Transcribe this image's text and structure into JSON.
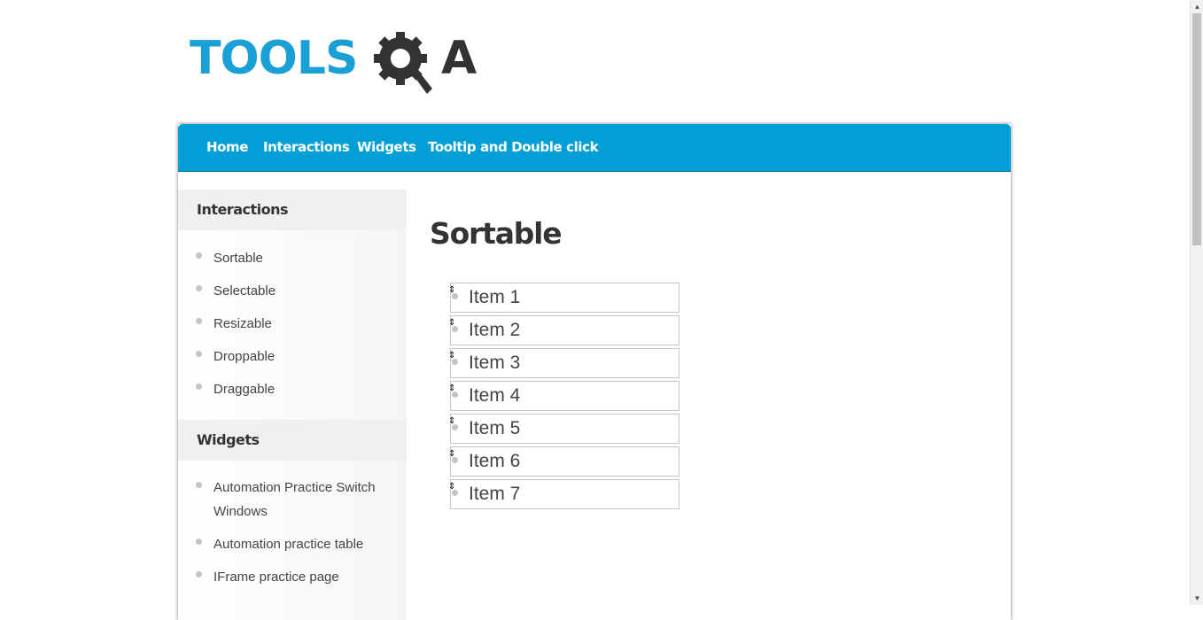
{
  "logo": {
    "text_left": "TOOLS",
    "text_right": "A",
    "icon": "gear-magnifier-icon",
    "colors": {
      "blue": "#1ba0d6",
      "dark": "#333333"
    }
  },
  "nav": {
    "background": "#029fd6",
    "items": [
      "Home",
      "Interactions",
      "Widgets",
      "Tooltip and Double click"
    ]
  },
  "sidebar": {
    "sections": [
      {
        "title": "Interactions",
        "items": [
          "Sortable",
          "Selectable",
          "Resizable",
          "Droppable",
          "Draggable"
        ]
      },
      {
        "title": "Widgets",
        "items": [
          "Automation Practice Switch Windows",
          "Automation practice table",
          "IFrame practice page"
        ]
      }
    ]
  },
  "main": {
    "title": "Sortable",
    "sortable_items": [
      "Item 1",
      "Item 2",
      "Item 3",
      "Item 4",
      "Item 5",
      "Item 6",
      "Item 7"
    ],
    "handle_icon": "sort-arrows-icon"
  }
}
